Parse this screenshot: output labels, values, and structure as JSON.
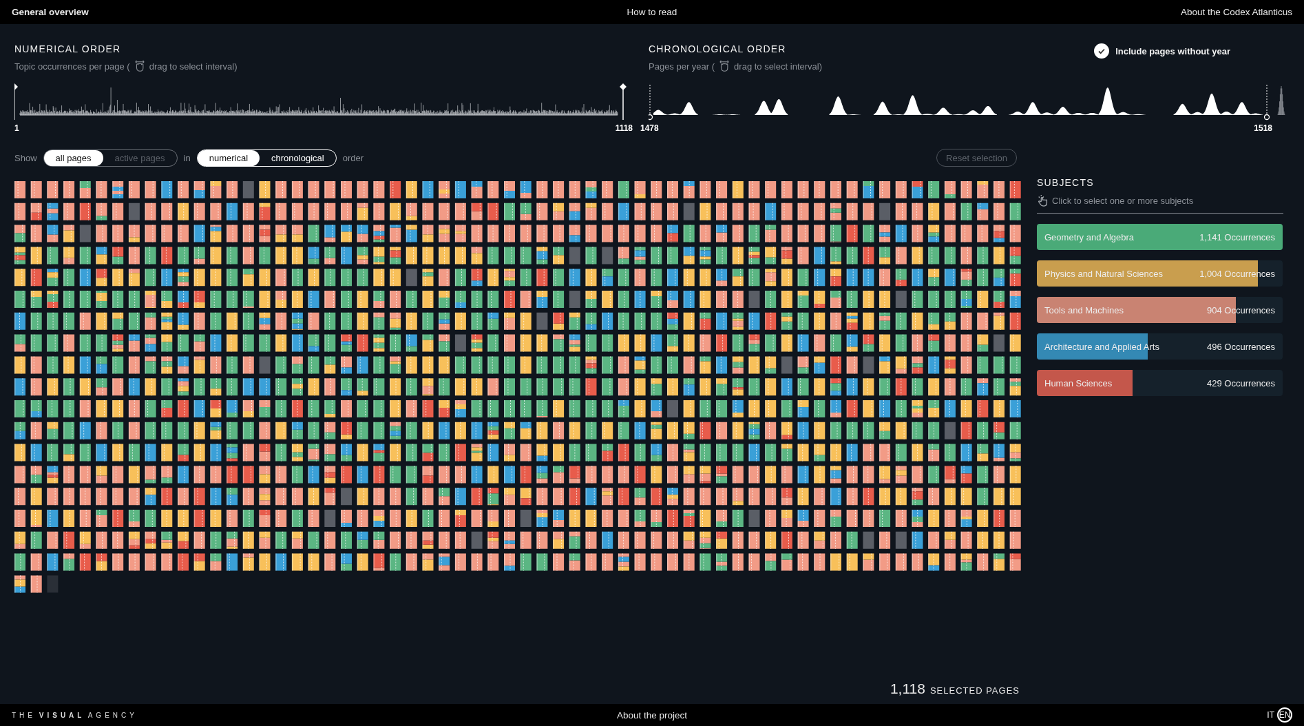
{
  "topbar": {
    "left": "General overview",
    "center": "How to read",
    "right": "About the Codex Atlanticus"
  },
  "numerical": {
    "title": "NUMERICAL ORDER",
    "subtitle_before": "Topic occurrences per page (",
    "subtitle_after": "drag to select interval)",
    "range_start": "1",
    "range_end": "1118"
  },
  "chronological": {
    "title": "CHRONOLOGICAL ORDER",
    "subtitle_before": "Pages per year (",
    "subtitle_after": "drag to select interval)",
    "range_start": "1478",
    "range_end": "1518",
    "include_without_year": {
      "label": "Include pages without year",
      "checked": true
    }
  },
  "controls": {
    "show_label": "Show",
    "show_options": [
      {
        "label": "all pages",
        "selected": true,
        "disabled": false
      },
      {
        "label": "active pages",
        "selected": false,
        "disabled": true
      }
    ],
    "in_label": "in",
    "order_options": [
      {
        "label": "numerical",
        "selected": true
      },
      {
        "label": "chronological",
        "selected": false
      }
    ],
    "order_label": "order",
    "reset": {
      "label": "Reset selection",
      "disabled": true
    }
  },
  "subjects": {
    "title": "SUBJECTS",
    "hint": "Click to select one or more subjects",
    "items": [
      {
        "label": "Geometry and Algebra",
        "count": "1,141 Occurrences",
        "level": 1,
        "color": "#4aaa78"
      },
      {
        "label": "Physics and Natural Sciences",
        "count": "1,004 Occurrences",
        "level": 0.9,
        "color": "#c99e4e"
      },
      {
        "label": "Tools and Machines",
        "count": "904 Occurrences",
        "level": 0.81,
        "color": "#c98372"
      },
      {
        "label": "Architecture and Applied Arts",
        "count": "496 Occurrences",
        "level": 0.45,
        "color": "#3489b4"
      },
      {
        "label": "Human Sciences",
        "count": "429 Occurrences",
        "level": 0.39,
        "color": "#c4574b"
      }
    ]
  },
  "selected_count": {
    "number": "1,118",
    "label": "SELECTED PAGES"
  },
  "footer": {
    "logo": "THE **VISUAL** AGENCY",
    "center": "About the project",
    "languages": [
      {
        "label": "IT",
        "selected": false
      },
      {
        "label": "EN",
        "selected": true
      }
    ]
  }
}
